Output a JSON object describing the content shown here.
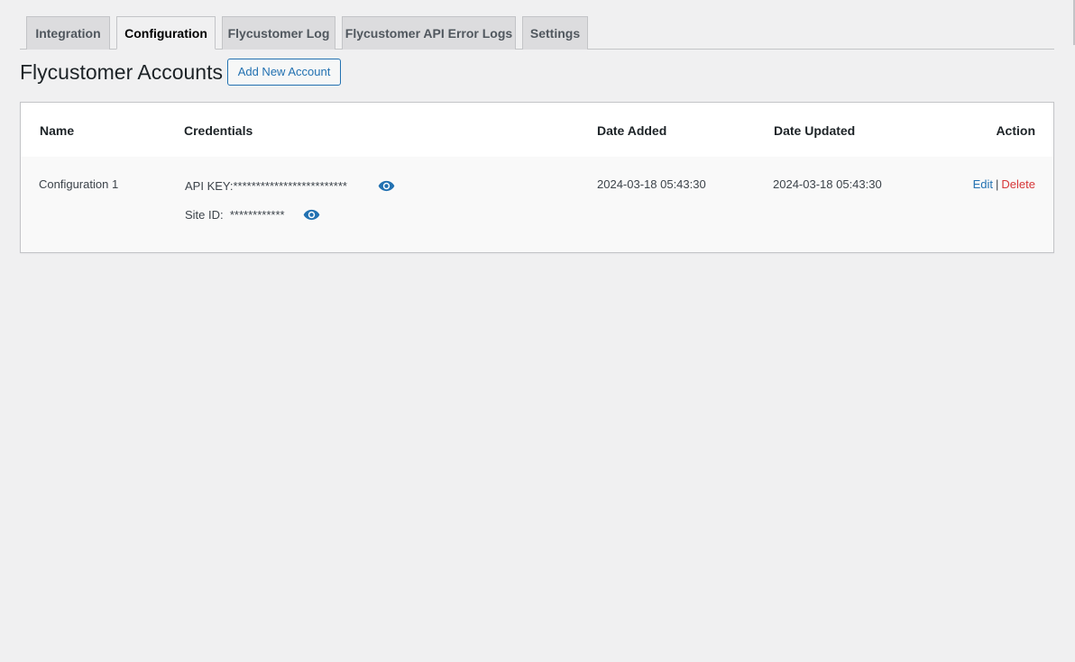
{
  "tabs": [
    {
      "label": "Integration",
      "active": false
    },
    {
      "label": "Configuration",
      "active": true
    },
    {
      "label": "Flycustomer Log",
      "active": false
    },
    {
      "label": "Flycustomer API Error Logs",
      "active": false
    },
    {
      "label": "Settings",
      "active": false
    }
  ],
  "page": {
    "title": "Flycustomer Accounts",
    "add_button_label": "Add New Account"
  },
  "table": {
    "headers": {
      "name": "Name",
      "credentials": "Credentials",
      "date_added": "Date Added",
      "date_updated": "Date Updated",
      "action": "Action"
    },
    "rows": [
      {
        "name": "Configuration 1",
        "api_key_label": "API KEY:",
        "api_key_masked": "*************************",
        "site_id_label": "Site ID:",
        "site_id_masked": "************",
        "date_added": "2024-03-18 05:43:30",
        "date_updated": "2024-03-18 05:43:30",
        "edit_label": "Edit",
        "separator": "|",
        "delete_label": "Delete"
      }
    ]
  },
  "icons": {
    "reveal": "eye-icon"
  },
  "colors": {
    "link": "#2271b1",
    "delete": "#d63638",
    "background": "#f0f0f1"
  }
}
